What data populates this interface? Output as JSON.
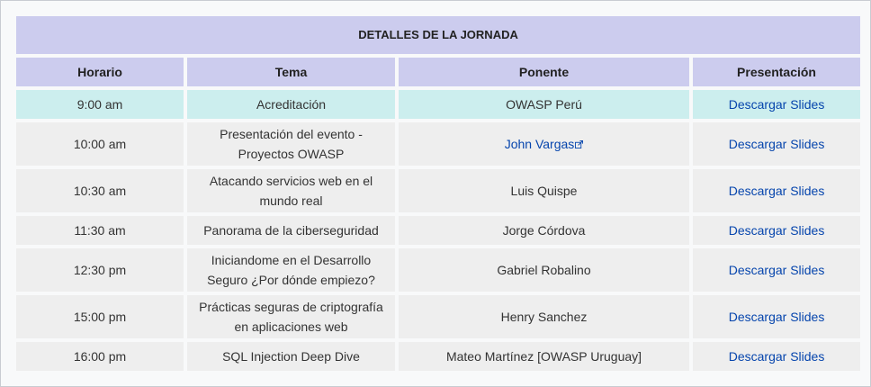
{
  "table": {
    "title": "DETALLES DE LA JORNADA",
    "headers": {
      "horario": "Horario",
      "tema": "Tema",
      "ponente": "Ponente",
      "presentacion": "Presentación"
    },
    "rows": [
      {
        "horario": "9:00 am",
        "tema": "Acreditación",
        "ponente": "OWASP Perú",
        "presentacion": "Descargar Slides"
      },
      {
        "horario": "10:00 am",
        "tema": "Presentación del evento - Proyectos OWASP",
        "ponente": "John Vargas",
        "presentacion": "Descargar Slides"
      },
      {
        "horario": "10:30 am",
        "tema": "Atacando servicios web en el mundo real",
        "ponente": "Luis Quispe",
        "presentacion": "Descargar Slides"
      },
      {
        "horario": "11:30 am",
        "tema": "Panorama de la ciberseguridad",
        "ponente": "Jorge Córdova",
        "presentacion": "Descargar Slides"
      },
      {
        "horario": "12:30 pm",
        "tema": "Iniciandome en el Desarrollo Seguro ¿Por dónde empiezo?",
        "ponente": "Gabriel Robalino",
        "presentacion": "Descargar Slides"
      },
      {
        "horario": "15:00 pm",
        "tema": "Prácticas seguras de criptografía en aplicaciones web",
        "ponente": "Henry Sanchez",
        "presentacion": "Descargar Slides"
      },
      {
        "horario": "16:00 pm",
        "tema": "SQL Injection Deep Dive",
        "ponente": "Mateo Martínez [OWASP Uruguay]",
        "presentacion": "Descargar Slides"
      }
    ]
  },
  "colors": {
    "header_bg": "#ccccee",
    "highlight_bg": "#cceeee",
    "row_bg": "#eeeeee",
    "link": "#0645ad"
  },
  "icons": {
    "external_link": "external-link-icon"
  }
}
